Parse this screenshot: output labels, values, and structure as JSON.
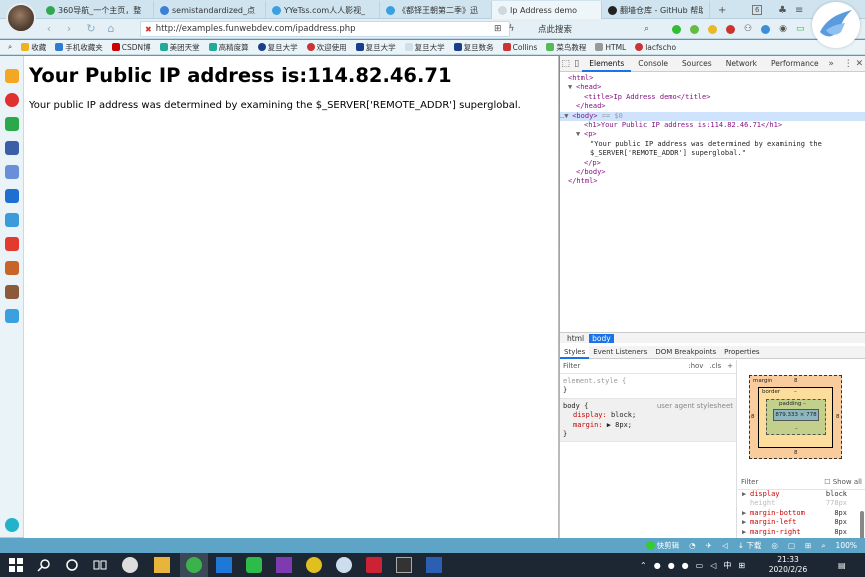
{
  "browser": {
    "tabs": [
      {
        "label": "360导航_一个主页，整",
        "color": "#2fa84f"
      },
      {
        "label": "semistandardized_点",
        "color": "#3b7fd9"
      },
      {
        "label": "YYeTss.com人人影视_",
        "color": "#3aa0e0"
      },
      {
        "label": "《都铎王朝第二季》迅",
        "color": "#3aa0e0"
      },
      {
        "label": "Ip Address demo",
        "color": "#9bb"
      },
      {
        "label": "翻墙仓库 - GitHub 帮助",
        "color": "#222222"
      }
    ],
    "new_tab": "+",
    "tab_count": "6",
    "url": "http://examples.funwebdev.com/ipaddress.php",
    "search_placeholder": "点此搜索",
    "bookmarks": [
      {
        "label": "收藏",
        "color": "#f0b020"
      },
      {
        "label": "手机收藏夹",
        "color": "#2d7dd2"
      },
      {
        "label": "CSDN博",
        "color": "#c00"
      },
      {
        "label": "美团天堂",
        "color": "#2a9"
      },
      {
        "label": "高精度算",
        "color": "#2a9"
      },
      {
        "label": "复旦大学",
        "color": "#1a3f8a"
      },
      {
        "label": "欢迎使用",
        "color": "#c33"
      },
      {
        "label": "复旦大学",
        "color": "#1a3f8a"
      },
      {
        "label": "复旦大学",
        "color": "#cfe0ea"
      },
      {
        "label": "复旦数务",
        "color": "#1a3f8a"
      },
      {
        "label": "Collins",
        "color": "#c33"
      },
      {
        "label": "菜鸟教程",
        "color": "#5b5"
      },
      {
        "label": "HTML",
        "color": "#999"
      },
      {
        "label": "lacfscho",
        "color": "#c33"
      }
    ]
  },
  "page": {
    "heading": "Your Public IP address is:114.82.46.71",
    "paragraph": "Your public IP address was determined by examining the $_SERVER['REMOTE_ADDR'] superglobal."
  },
  "devtools": {
    "tabs": [
      "Elements",
      "Console",
      "Sources",
      "Network",
      "Performance"
    ],
    "more": "»",
    "dom": {
      "html_open": "<html>",
      "head_open": "<head>",
      "title_line": "<title>Ip Address demo</title>",
      "head_close": "</head>",
      "body_open": "<body>",
      "body_suffix": "== $0",
      "h1_line": "<h1>Your Public IP address is:114.82.46.71</h1>",
      "p_open": "<p>",
      "p_text_1": "\"Your public IP address was determined by examining the",
      "p_text_2": "$_SERVER['REMOTE_ADDR'] superglobal.\"",
      "p_close": "</p>",
      "body_close": "</body>",
      "html_close": "</html>"
    },
    "crumbs": [
      "html",
      "body"
    ],
    "subtabs": [
      "Styles",
      "Event Listeners",
      "DOM Breakpoints",
      "Properties"
    ],
    "filter": "Filter",
    "hov": ":hov",
    "cls": ".cls",
    "element_style": "element.style {",
    "close_brace": "}",
    "body_rule": {
      "selector": "body {",
      "source": "user agent stylesheet",
      "props": [
        {
          "name": "display",
          "value": "block;"
        },
        {
          "name": "margin",
          "value": "▶ 8px;"
        }
      ]
    },
    "box_model": {
      "margin_label": "margin",
      "margin_value": "8",
      "border_label": "border",
      "border_value": "–",
      "padding_label": "padding –",
      "padding_bottom": "–",
      "content": "879.333 × 778",
      "side_left": "8",
      "side_right": "8",
      "dash": "–"
    },
    "computed": {
      "filter": "Filter",
      "show_all": "Show all",
      "rows": [
        {
          "name": "display",
          "value": "block",
          "dim": false
        },
        {
          "name": "height",
          "value": "778px",
          "dim": true
        },
        {
          "name": "margin-bottom",
          "value": "8px",
          "dim": false
        },
        {
          "name": "margin-left",
          "value": "8px",
          "dim": false
        },
        {
          "name": "margin-right",
          "value": "8px",
          "dim": false
        }
      ]
    }
  },
  "statusbar": {
    "clip": "快剪辑",
    "download": "下载",
    "zoom": "100%"
  },
  "taskbar": {
    "time": "21:33",
    "date": "2020/2/26",
    "ime": "中"
  }
}
